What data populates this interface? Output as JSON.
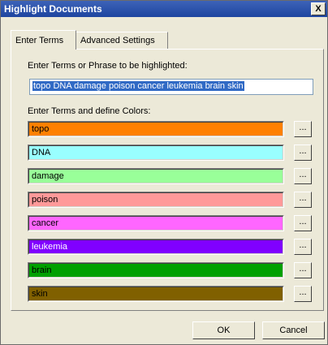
{
  "window": {
    "title": "Highlight Documents",
    "close_label": "X"
  },
  "tabs": [
    {
      "label": "Enter Terms"
    },
    {
      "label": "Advanced Settings"
    }
  ],
  "phrase": {
    "label": "Enter Terms or Phrase to be highlighted:",
    "value": "topo DNA damage poison cancer leukemia brain skin"
  },
  "terms_section": {
    "label": "Enter Terms and define Colors:"
  },
  "terms": [
    {
      "text": "topo",
      "color": "#ff8000",
      "text_color": "#000000",
      "picker_label": "..."
    },
    {
      "text": "DNA",
      "color": "#99ffff",
      "text_color": "#000000",
      "picker_label": "..."
    },
    {
      "text": "damage",
      "color": "#99ff99",
      "text_color": "#000000",
      "picker_label": "..."
    },
    {
      "text": "poison",
      "color": "#ff9999",
      "text_color": "#000000",
      "picker_label": "..."
    },
    {
      "text": "cancer",
      "color": "#ff66ff",
      "text_color": "#000000",
      "picker_label": "..."
    },
    {
      "text": "leukemia",
      "color": "#8000ff",
      "text_color": "#ffffff",
      "picker_label": "..."
    },
    {
      "text": "brain",
      "color": "#00a000",
      "text_color": "#000000",
      "picker_label": "..."
    },
    {
      "text": "skin",
      "color": "#806000",
      "text_color": "#000000",
      "picker_label": "..."
    }
  ],
  "buttons": {
    "ok": "OK",
    "cancel": "Cancel"
  }
}
